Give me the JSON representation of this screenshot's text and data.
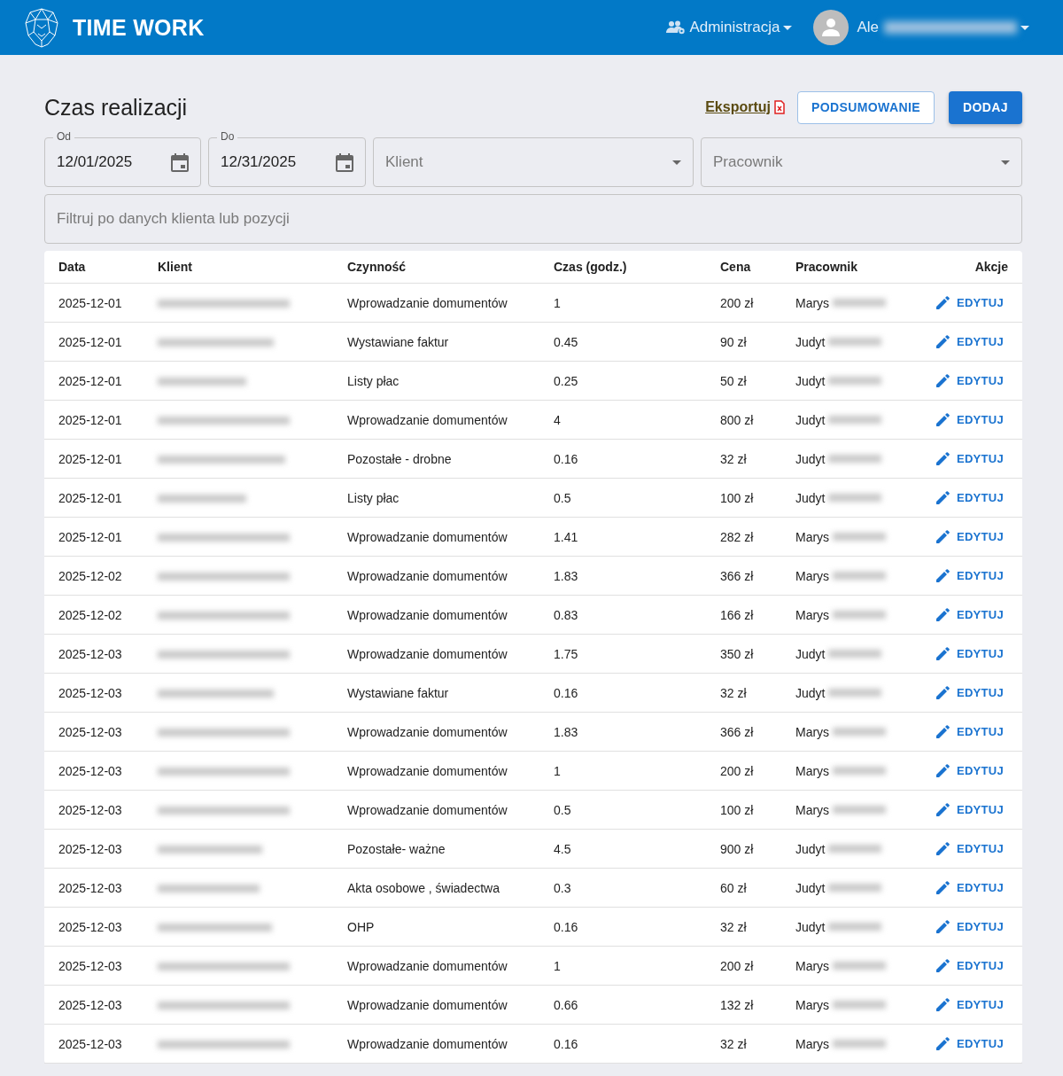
{
  "app_bar": {
    "brand": "TIME WORK",
    "admin_menu": "Administracja",
    "user_name": "Ale"
  },
  "page": {
    "title": "Czas realizacji",
    "export_link": "Eksportuj",
    "summary_button": "PODSUMOWANIE",
    "add_button": "DODAJ"
  },
  "filters": {
    "from": {
      "label": "Od",
      "value": "12/01/2025"
    },
    "to": {
      "label": "Do",
      "value": "12/31/2025"
    },
    "client": {
      "placeholder": "Klient"
    },
    "employee": {
      "placeholder": "Pracownik"
    },
    "search": {
      "placeholder": "Filtruj po danych klienta lub pozycji"
    }
  },
  "table": {
    "columns": [
      "Data",
      "Klient",
      "Czynność",
      "Czas (godz.)",
      "Cena",
      "Pracownik",
      "Akcje"
    ],
    "rows": [
      {
        "date": "2025-12-01",
        "activity": "Wprowadzanie domumentów",
        "hours": "1",
        "price": "200 zł",
        "employee": "Marys",
        "action": "EDYTUJ"
      },
      {
        "date": "2025-12-01",
        "activity": "Wystawiane faktur",
        "hours": "0.45",
        "price": "90 zł",
        "employee": "Judyt",
        "action": "EDYTUJ"
      },
      {
        "date": "2025-12-01",
        "activity": "Listy płac",
        "hours": "0.25",
        "price": "50 zł",
        "employee": "Judyt",
        "action": "EDYTUJ"
      },
      {
        "date": "2025-12-01",
        "activity": "Wprowadzanie domumentów",
        "hours": "4",
        "price": "800 zł",
        "employee": "Judyt",
        "action": "EDYTUJ"
      },
      {
        "date": "2025-12-01",
        "activity": "Pozostałe - drobne",
        "hours": "0.16",
        "price": "32 zł",
        "employee": "Judyt",
        "action": "EDYTUJ"
      },
      {
        "date": "2025-12-01",
        "activity": "Listy płac",
        "hours": "0.5",
        "price": "100 zł",
        "employee": "Judyt",
        "action": "EDYTUJ"
      },
      {
        "date": "2025-12-01",
        "activity": "Wprowadzanie domumentów",
        "hours": "1.41",
        "price": "282 zł",
        "employee": "Marys",
        "action": "EDYTUJ"
      },
      {
        "date": "2025-12-02",
        "activity": "Wprowadzanie domumentów",
        "hours": "1.83",
        "price": "366 zł",
        "employee": "Marys",
        "action": "EDYTUJ"
      },
      {
        "date": "2025-12-02",
        "activity": "Wprowadzanie domumentów",
        "hours": "0.83",
        "price": "166 zł",
        "employee": "Marys",
        "action": "EDYTUJ"
      },
      {
        "date": "2025-12-03",
        "activity": "Wprowadzanie domumentów",
        "hours": "1.75",
        "price": "350 zł",
        "employee": "Judyt",
        "action": "EDYTUJ"
      },
      {
        "date": "2025-12-03",
        "activity": "Wystawiane faktur",
        "hours": "0.16",
        "price": "32 zł",
        "employee": "Judyt",
        "action": "EDYTUJ"
      },
      {
        "date": "2025-12-03",
        "activity": "Wprowadzanie domumentów",
        "hours": "1.83",
        "price": "366 zł",
        "employee": "Marys",
        "action": "EDYTUJ"
      },
      {
        "date": "2025-12-03",
        "activity": "Wprowadzanie domumentów",
        "hours": "1",
        "price": "200 zł",
        "employee": "Marys",
        "action": "EDYTUJ"
      },
      {
        "date": "2025-12-03",
        "activity": "Wprowadzanie domumentów",
        "hours": "0.5",
        "price": "100 zł",
        "employee": "Marys",
        "action": "EDYTUJ"
      },
      {
        "date": "2025-12-03",
        "activity": "Pozostałe- ważne",
        "hours": "4.5",
        "price": "900 zł",
        "employee": "Judyt",
        "action": "EDYTUJ"
      },
      {
        "date": "2025-12-03",
        "activity": "Akta osobowe , świadectwa",
        "hours": "0.3",
        "price": "60 zł",
        "employee": "Judyt",
        "action": "EDYTUJ"
      },
      {
        "date": "2025-12-03",
        "activity": "OHP",
        "hours": "0.16",
        "price": "32 zł",
        "employee": "Judyt",
        "action": "EDYTUJ"
      },
      {
        "date": "2025-12-03",
        "activity": "Wprowadzanie domumentów",
        "hours": "1",
        "price": "200 zł",
        "employee": "Marys",
        "action": "EDYTUJ"
      },
      {
        "date": "2025-12-03",
        "activity": "Wprowadzanie domumentów",
        "hours": "0.66",
        "price": "132 zł",
        "employee": "Marys",
        "action": "EDYTUJ"
      },
      {
        "date": "2025-12-03",
        "activity": "Wprowadzanie domumentów",
        "hours": "0.16",
        "price": "32 zł",
        "employee": "Marys",
        "action": "EDYTUJ"
      }
    ]
  }
}
